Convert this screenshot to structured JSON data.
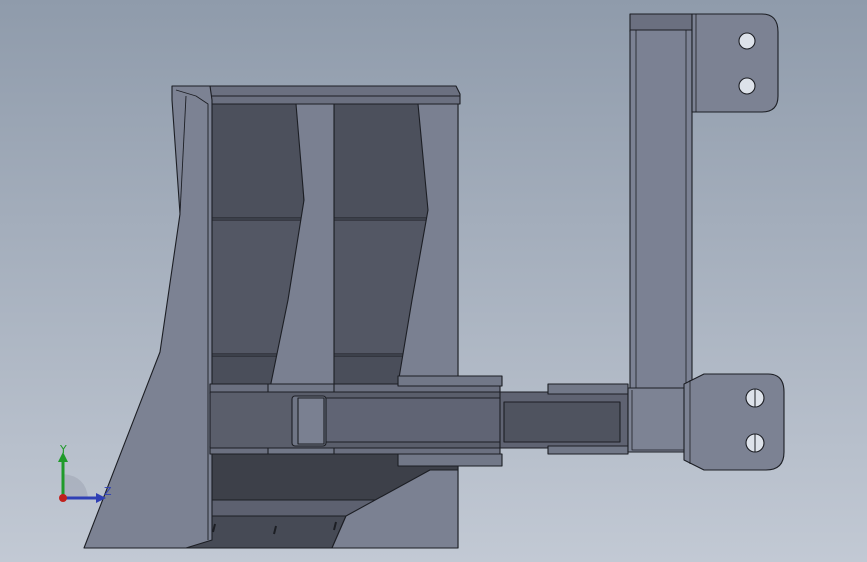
{
  "viewport": {
    "background_top": "#8f9bab",
    "background_bottom": "#c2c9d4"
  },
  "model": {
    "body_color": "#787e8f",
    "face_light": "#8a91a2",
    "face_dark": "#4f535f",
    "edge_color": "#1c1e24"
  },
  "triad": {
    "y_label": "Y",
    "z_label": "Z",
    "y_color": "#1f9a2a",
    "z_color": "#2f3fb5",
    "x_color": "#c0201c"
  }
}
